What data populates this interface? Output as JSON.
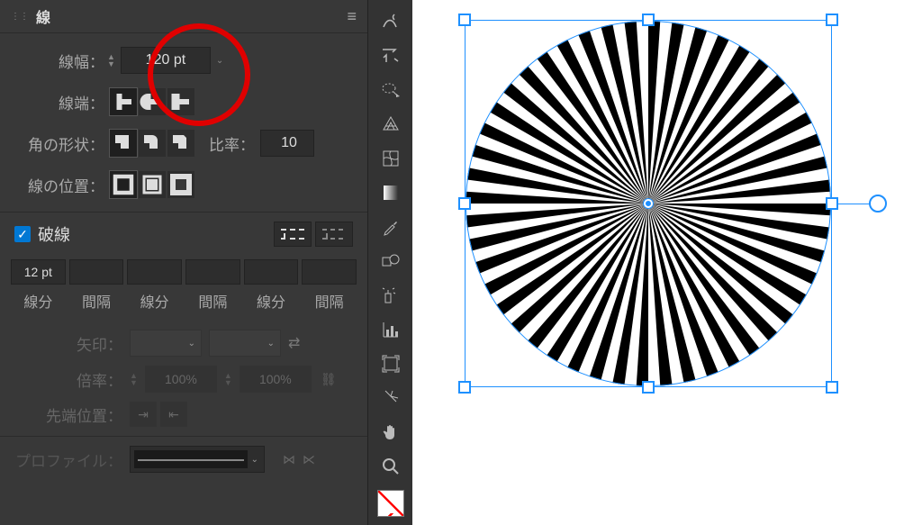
{
  "panel": {
    "title": "線",
    "stroke_weight_label": "線幅：",
    "stroke_weight_value": "120 pt",
    "cap_label": "線端：",
    "corner_label": "角の形状：",
    "ratio_label": "比率：",
    "ratio_value": "10",
    "align_label": "線の位置：",
    "dash_checkbox_label": "破線",
    "dash_checked": true,
    "dash_values": [
      "12 pt",
      "",
      "",
      "",
      "",
      ""
    ],
    "dash_sublabels": [
      "線分",
      "間隔",
      "線分",
      "間隔",
      "線分",
      "間隔"
    ],
    "arrow_label": "矢印：",
    "scale_label": "倍率：",
    "scale_value_1": "100%",
    "scale_value_2": "100%",
    "tip_label": "先端位置：",
    "profile_label": "プロファイル："
  },
  "toolbar_tools": [
    "curvature-tool-icon",
    "lasso-icon",
    "magic-wand-icon",
    "perspective-icon",
    "mesh-icon",
    "gradient-icon",
    "eyedropper-icon",
    "blend-icon",
    "symbol-sprayer-icon",
    "graph-icon",
    "crop-icon",
    "slice-icon",
    "hand-icon",
    "zoom-icon"
  ],
  "colors": {
    "highlight_ring": "#e00000",
    "selection": "#1e90ff",
    "panel_bg": "#383838"
  },
  "artwork": {
    "type": "sunburst-circle",
    "spokes": 48,
    "stroke_color": "#000000",
    "fill": "#ffffff"
  }
}
